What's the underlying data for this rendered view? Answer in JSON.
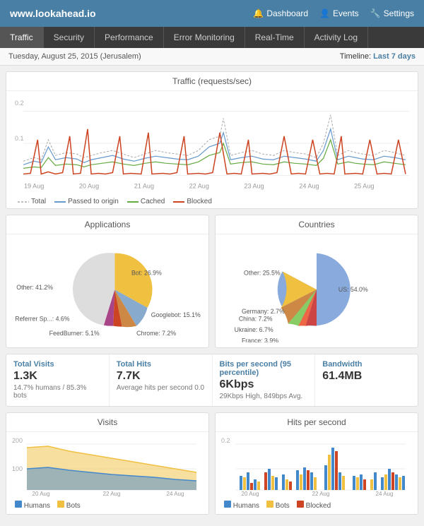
{
  "header": {
    "logo": "www.lookahead.io",
    "nav": [
      {
        "label": "Dashboard",
        "icon": "🔔"
      },
      {
        "label": "Events",
        "icon": "👤"
      },
      {
        "label": "Settings",
        "icon": "🔧"
      }
    ]
  },
  "tabs": [
    {
      "label": "Traffic",
      "active": true
    },
    {
      "label": "Security",
      "active": false
    },
    {
      "label": "Performance",
      "active": false
    },
    {
      "label": "Error Monitoring",
      "active": false
    },
    {
      "label": "Real-Time",
      "active": false
    },
    {
      "label": "Activity Log",
      "active": false
    }
  ],
  "datebar": {
    "date": "Tuesday, August 25, 2015 (Jerusalem)",
    "timeline_label": "Timeline:",
    "timeline_value": "Last 7 days"
  },
  "traffic_chart": {
    "title": "Traffic (requests/sec)",
    "y_labels": [
      "0.2",
      "0.1"
    ],
    "x_labels": [
      "19 Aug",
      "20 Aug",
      "21 Aug",
      "22 Aug",
      "23 Aug",
      "24 Aug",
      "25 Aug"
    ],
    "legend": [
      {
        "label": "Total",
        "type": "total"
      },
      {
        "label": "Passed to origin",
        "type": "passed"
      },
      {
        "label": "Cached",
        "type": "cached"
      },
      {
        "label": "Blocked",
        "type": "blocked"
      }
    ]
  },
  "applications": {
    "title": "Applications",
    "slices": [
      {
        "label": "Bot: 26.9%",
        "value": 26.9,
        "color": "#f0c040",
        "angle": 97
      },
      {
        "label": "Googlebot: 15.1%",
        "value": 15.1,
        "color": "#88aacc",
        "angle": 54
      },
      {
        "label": "Chrome: 7.2%",
        "value": 7.2,
        "color": "#cc8844",
        "angle": 26
      },
      {
        "label": "FeedBurner: 5.1%",
        "value": 5.1,
        "color": "#cc4422",
        "angle": 18
      },
      {
        "label": "Referrer Sp...: 4.6%",
        "value": 4.6,
        "color": "#aa4488",
        "angle": 17
      },
      {
        "label": "Other: 41.2%",
        "value": 41.2,
        "color": "#dddddd",
        "angle": 148
      }
    ]
  },
  "countries": {
    "title": "Countries",
    "slices": [
      {
        "label": "US: 54.0%",
        "value": 54.0,
        "color": "#88aadd",
        "angle": 194
      },
      {
        "label": "Other: 25.5%",
        "value": 25.5,
        "color": "#f0c040",
        "angle": 92
      },
      {
        "label": "China: 7.2%",
        "value": 7.2,
        "color": "#cc8844",
        "angle": 26
      },
      {
        "label": "Ukraine: 6.7%",
        "value": 6.7,
        "color": "#88cc66",
        "angle": 24
      },
      {
        "label": "France: 3.9%",
        "value": 3.9,
        "color": "#ee6644",
        "angle": 14
      },
      {
        "label": "Germany: 2.7%",
        "value": 2.7,
        "color": "#cc4444",
        "angle": 10
      }
    ]
  },
  "stats": [
    {
      "label": "Total Visits",
      "value": "1.3K",
      "sub": "14.7% humans / 85.3% bots"
    },
    {
      "label": "Total Hits",
      "value": "7.7K",
      "sub": "Average hits per second 0.0"
    },
    {
      "label": "Bits per second (95 percentile)",
      "value": "6Kbps",
      "sub": "29Kbps High, 849bps Avg."
    },
    {
      "label": "Bandwidth",
      "value": "61.4MB",
      "sub": ""
    }
  ],
  "visits_chart": {
    "title": "Visits",
    "y_labels": [
      "200",
      "100"
    ],
    "x_labels": [
      "20 Aug",
      "22 Aug",
      "24 Aug"
    ],
    "legend": [
      {
        "label": "Humans",
        "color": "#4488cc"
      },
      {
        "label": "Bots",
        "color": "#f0c040"
      }
    ]
  },
  "hits_chart": {
    "title": "Hits per second",
    "y_labels": [
      "0.2"
    ],
    "x_labels": [
      "20 Aug",
      "22 Aug",
      "24 Aug"
    ],
    "legend": [
      {
        "label": "Humans",
        "color": "#4488cc"
      },
      {
        "label": "Bots",
        "color": "#f0c040"
      },
      {
        "label": "Blocked",
        "color": "#cc4422"
      }
    ]
  }
}
